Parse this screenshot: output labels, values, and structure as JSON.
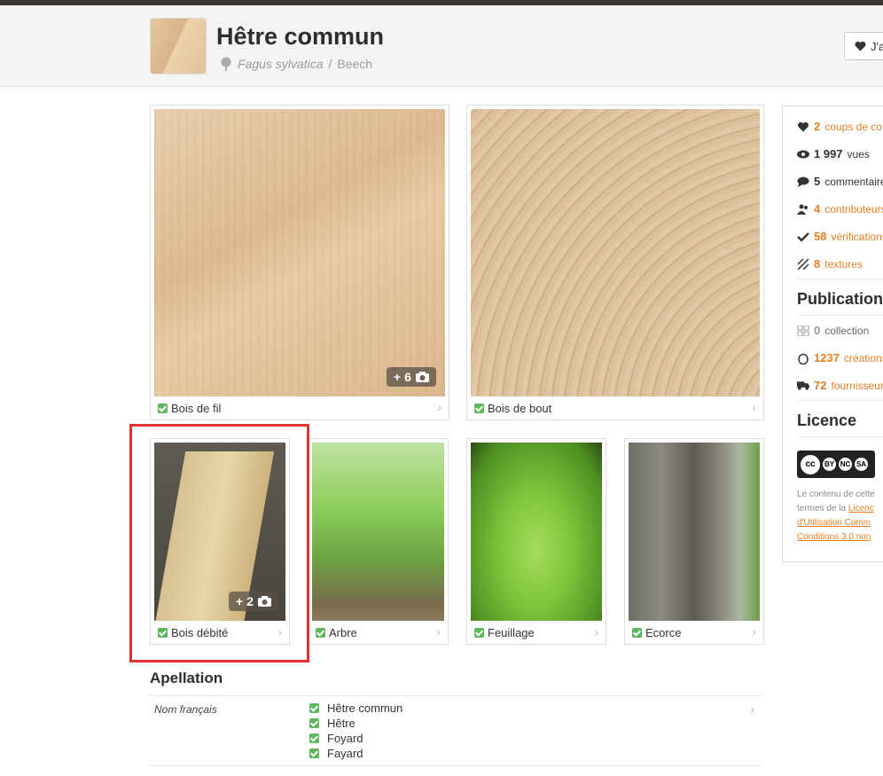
{
  "header": {
    "title": "Hêtre commun",
    "latin_name": "Fagus sylvatica",
    "separator": "/",
    "english_name": "Beech",
    "like_label": "J'a"
  },
  "gallery": {
    "tiles": [
      {
        "label": "Bois de fil",
        "badge": "+ 6"
      },
      {
        "label": "Bois de bout"
      },
      {
        "label": "Bois débité",
        "badge": "+ 2"
      },
      {
        "label": "Arbre"
      },
      {
        "label": "Feuillage"
      },
      {
        "label": "Ecorce"
      }
    ]
  },
  "stats": [
    {
      "num": "2",
      "text": "coups de co",
      "icon": "heart-icon",
      "accent": true
    },
    {
      "num": "1 997",
      "text": "vues",
      "icon": "eye-icon",
      "accent": false
    },
    {
      "num": "5",
      "text": "commentaire",
      "icon": "comment-icon",
      "accent": false
    },
    {
      "num": "4",
      "text": "contributeurs",
      "icon": "users-icon",
      "accent": true
    },
    {
      "num": "58",
      "text": "vérifications",
      "icon": "check-icon",
      "accent": true
    },
    {
      "num": "8",
      "text": "textures",
      "icon": "texture-icon",
      "accent": true
    }
  ],
  "publications": {
    "title": "Publications",
    "items": [
      {
        "num": "0",
        "text": "collection",
        "icon": "grid-icon",
        "accent": false
      },
      {
        "num": "1237",
        "text": "créations",
        "icon": "egg-icon",
        "accent": true
      },
      {
        "num": "72",
        "text": "fournisseurs",
        "icon": "truck-icon",
        "accent": true
      }
    ]
  },
  "licence": {
    "title": "Licence",
    "badge": {
      "cc": "cc",
      "by": "BY",
      "nc": "NC",
      "sa": "SA"
    },
    "lines": [
      "Le contenu de cette",
      "termes de la",
      "d'Utilisation Comm",
      "Conditions 3.0 non"
    ],
    "link_word": "Licenc"
  },
  "apellation": {
    "title": "Apellation",
    "rows": [
      {
        "label": "Nom français",
        "values": [
          "Hêtre commun",
          "Hêtre",
          "Foyard",
          "Fayard"
        ]
      }
    ]
  },
  "colors": {
    "accent": "#e67e22",
    "check": "#5cb85c",
    "highlight": "#e3342f"
  }
}
